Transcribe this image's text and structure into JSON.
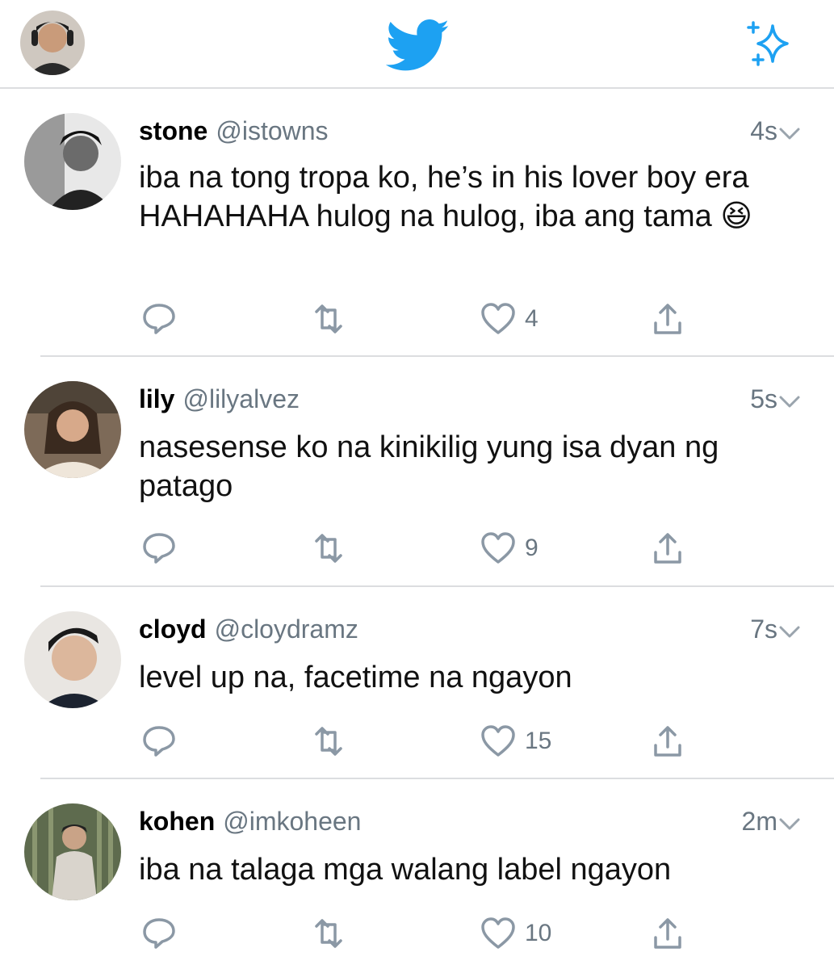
{
  "header": {
    "profile_avatar": "profile-avatar",
    "logo": "twitter-bird-icon",
    "right_icon": "sparkle-icon",
    "accent_color": "#1DA1F2"
  },
  "tweets": [
    {
      "name": "stone",
      "handle": "@istowns",
      "time": "4s",
      "text": "iba na tong tropa ko, he’s in his lover boy era HAHAHAHA hulog na hulog, iba ang tama 😆",
      "likes": "4",
      "avatar_color": "#3a3a3a"
    },
    {
      "name": "lily",
      "handle": "@lilyalvez",
      "time": "5s",
      "text": "nasesense ko na kinikilig yung isa dyan ng patago",
      "likes": "9",
      "avatar_color": "#b08a6a"
    },
    {
      "name": "cloyd",
      "handle": "@cloydramz",
      "time": "7s",
      "text": "level up na, facetime na ngayon",
      "likes": "15",
      "avatar_color": "#c9a88e"
    },
    {
      "name": "kohen",
      "handle": "@imkoheen",
      "time": "2m",
      "text": "iba na talaga mga walang label ngayon",
      "likes": "10",
      "avatar_color": "#7a8a6a"
    }
  ]
}
